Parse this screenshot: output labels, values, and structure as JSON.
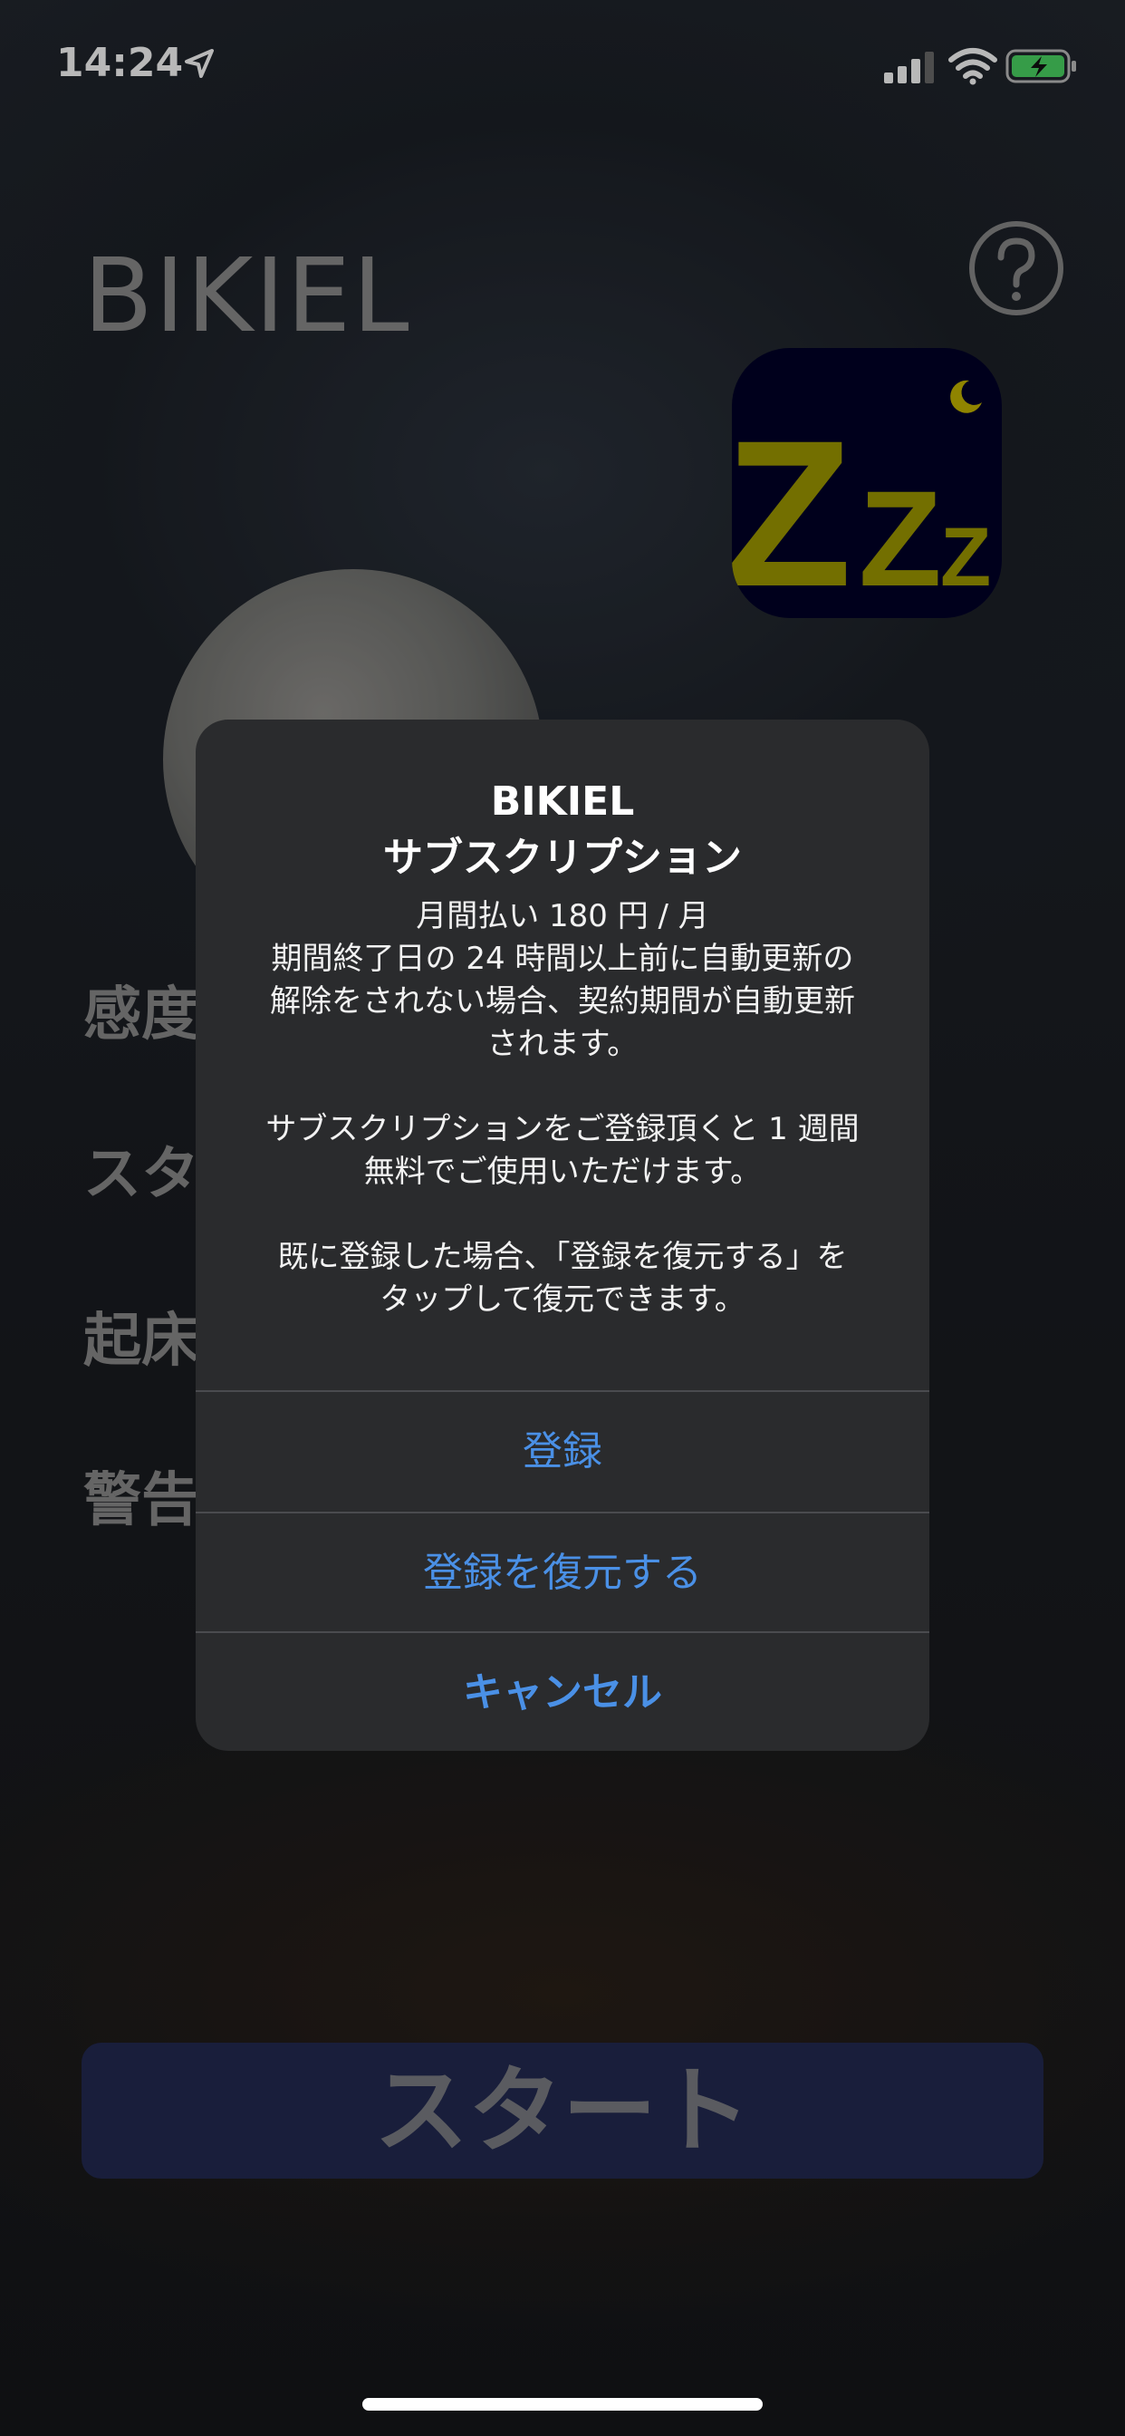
{
  "status_bar": {
    "time": "14:24"
  },
  "app": {
    "title": "BIKIEL",
    "icon_text": "Zzz",
    "settings_rows": [
      "感度",
      "スタ",
      "起床",
      "警告"
    ],
    "start_label": "スタート"
  },
  "alert": {
    "title_line1": "BIKIEL",
    "title_line2": "サブスクリプション",
    "message_lines": [
      "月間払い 180 円 / 月",
      "期間終了日の 24 時間以上前に自動更新の",
      "解除をされない場合、契約期間が自動更新",
      "されます。",
      "",
      "サブスクリプションをご登録頂くと 1 週間",
      "無料でご使用いただけます。",
      "",
      "既に登録した場合、「登録を復元する」を",
      "タップして復元できます。"
    ],
    "buttons": {
      "subscribe": "登録",
      "restore": "登録を復元する",
      "cancel": "キャンセル"
    }
  },
  "colors": {
    "accent": "#4a90e6",
    "start_button": "#232a52",
    "icon_bg": "#000027",
    "icon_letters": "#a09a00"
  }
}
